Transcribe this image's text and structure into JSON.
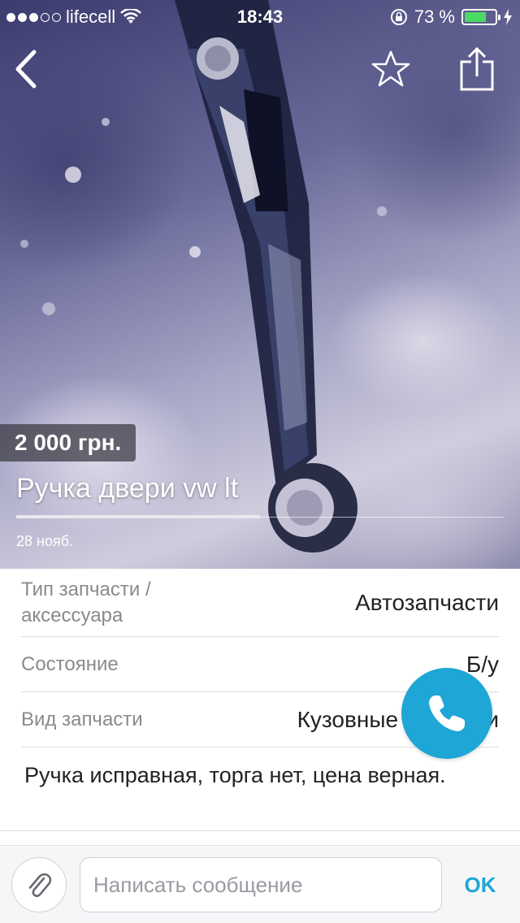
{
  "status_bar": {
    "carrier": "lifecell",
    "time": "18:43",
    "battery": "73 %",
    "battery_level": 0.73
  },
  "listing": {
    "price": "2 000 грн.",
    "title": "Ручка двери vw lt",
    "date": "28  нояб.",
    "image_progress": 0.5
  },
  "details": [
    {
      "label": "Тип запчасти / аксессуара",
      "value": "Автозапчасти"
    },
    {
      "label": "Состояние",
      "value": "Б/у"
    },
    {
      "label": "Вид запчасти",
      "value": "Кузовные запчасти"
    }
  ],
  "description": "Ручка исправная, торга нет, цена верная.",
  "composer": {
    "placeholder": "Написать сообщение",
    "send_label": "OK"
  },
  "icons": {
    "back": "chevron-left-icon",
    "favorite": "star-icon",
    "share": "share-icon",
    "call": "phone-icon",
    "attach": "paperclip-icon"
  },
  "colors": {
    "accent": "#1ea6d6",
    "battery": "#4cd964"
  }
}
